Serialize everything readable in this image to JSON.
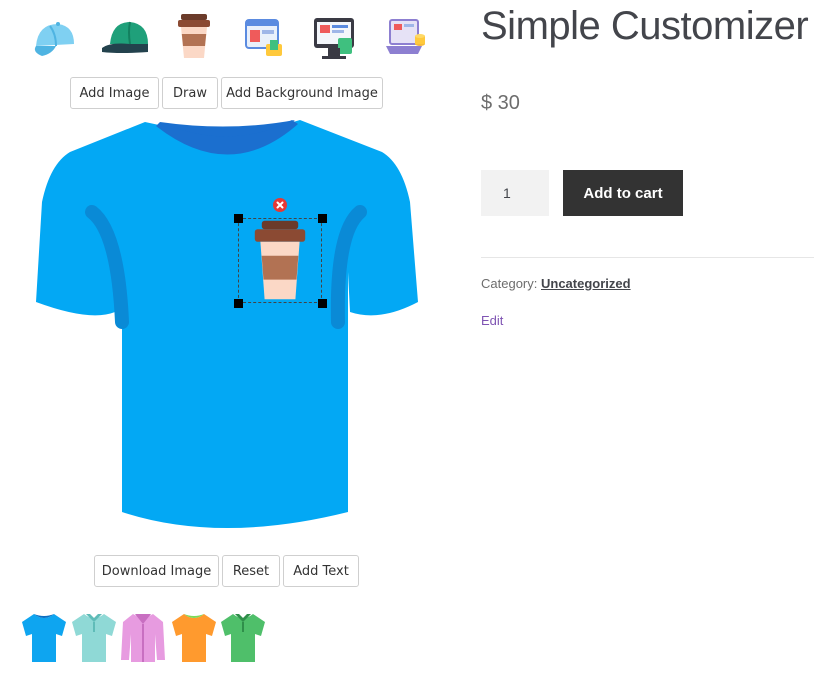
{
  "product": {
    "title": "Simple Customizer",
    "price": "$ 30",
    "quantity": "1",
    "add_to_cart_label": "Add to cart",
    "category_label": "Category:",
    "category_value": "Uncategorized",
    "edit_label": "Edit"
  },
  "toolbar_top": {
    "add_image": "Add Image",
    "draw": "Draw",
    "add_background_image": "Add Background Image"
  },
  "toolbar_bottom": {
    "download_image": "Download Image",
    "reset": "Reset",
    "add_text": "Add Text"
  },
  "stickers": [
    {
      "icon": "light-blue-cap-icon"
    },
    {
      "icon": "green-cap-icon"
    },
    {
      "icon": "coffee-cup-icon"
    },
    {
      "icon": "web-design-icon"
    },
    {
      "icon": "monitor-dashboard-icon"
    },
    {
      "icon": "laptop-coins-icon"
    }
  ],
  "shirt_variants": [
    {
      "icon": "blue-tshirt-icon",
      "color": "#0ea5f0"
    },
    {
      "icon": "teal-polo-icon",
      "color": "#8fd9d6"
    },
    {
      "icon": "pink-shirt-icon",
      "color": "#e79be0"
    },
    {
      "icon": "orange-tshirt-icon",
      "color": "#ff9a2e"
    },
    {
      "icon": "green-polo-icon",
      "color": "#4fbf6a"
    }
  ],
  "colors": {
    "shirt": "#03a8f4",
    "shirt_shade": "#0a8ad6",
    "collar": "#1b6fcf",
    "cart_button": "#333333",
    "edit_link": "#7f54b3"
  }
}
